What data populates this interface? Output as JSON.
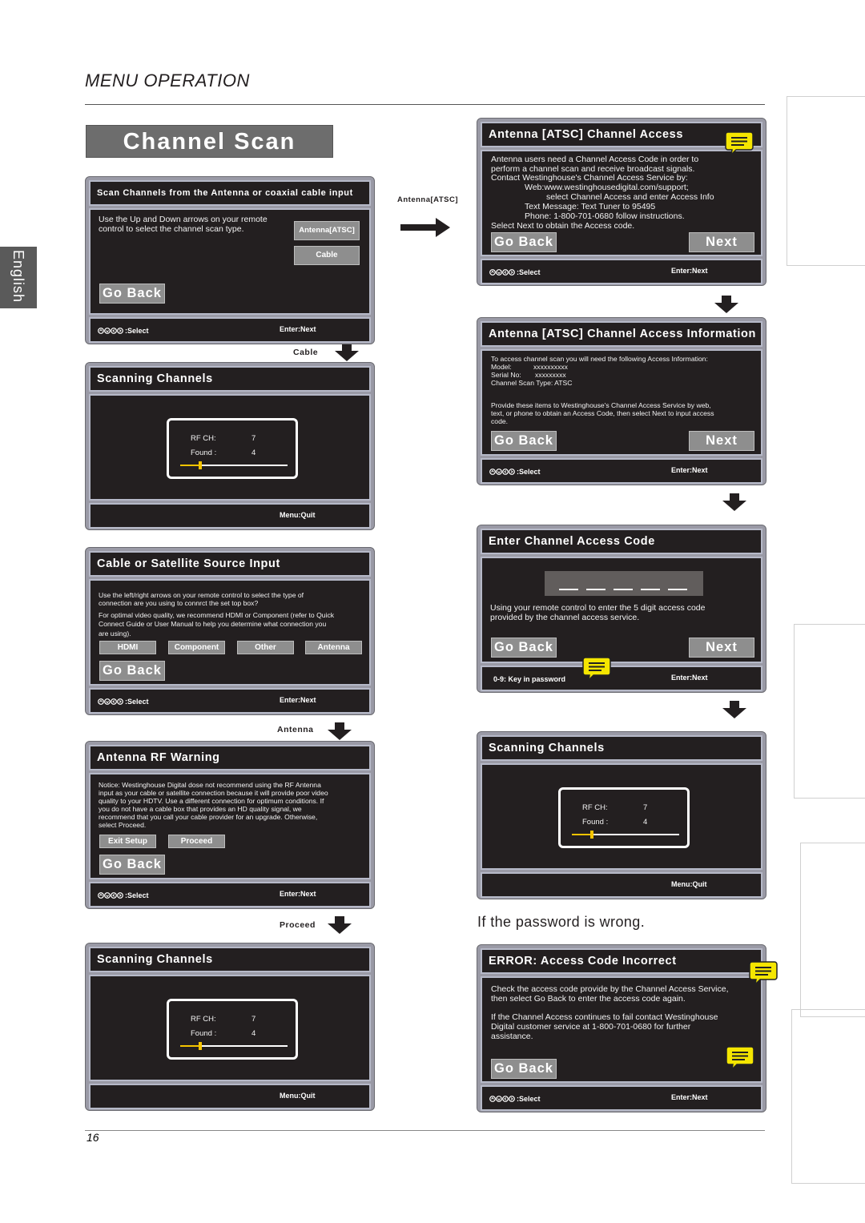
{
  "page": {
    "section_title": "MENU OPERATION",
    "banner": "Channel Scan",
    "language_tab": "English",
    "page_number": "16",
    "note_wrong_password": "If the password is wrong."
  },
  "colors": {
    "screen_bg": "#231f20",
    "button": "#8e8e8e",
    "note": "#f5e600",
    "progress": "#f5c400"
  },
  "icons": {
    "select": "four-direction-arrows-icon",
    "note": "speech-bubble-note-icon",
    "flow": "arrow-icon"
  },
  "flow": {
    "antenna_atsc": "Antenna[ATSC]",
    "cable": "Cable",
    "antenna": "Antenna",
    "proceed": "Proceed"
  },
  "common": {
    "go_back": "Go Back",
    "next": "Next",
    "select": ":Select",
    "enter_next": "Enter:Next",
    "menu_quit": "Menu:Quit",
    "rf_ch": "RF  CH:",
    "rf_ch_value": "7",
    "found": "Found :",
    "found_value": "4",
    "scan_progress_percent": 17
  },
  "l1": {
    "title": "Scan Channels from the Antenna or coaxial cable input",
    "text": [
      "Use the Up and Down arrows on your remote",
      "control to select the channel scan type."
    ],
    "options": [
      "Antenna[ATSC]",
      "Cable"
    ]
  },
  "l2": {
    "title": "Scanning Channels"
  },
  "l3": {
    "title": "Cable or Satellite Source Input",
    "text": [
      "Use the left/right arrows on your remote control to select the type of",
      "connection are you using to connrct the set top box?",
      "For optimal video quality, we recommend HDMI or Component (refer to Quick",
      "Connect Guide or User Manual to help you determine what connection you",
      "are using)."
    ],
    "options": [
      "HDMI",
      "Component",
      "Other",
      "Antenna"
    ]
  },
  "l4": {
    "title": "Antenna RF Warning",
    "text": [
      "Notice: Westinghouse Digital dose not recommend using the RF Antenna",
      "input as your cable or satellite connection because it will provide poor video",
      "quality to your HDTV. Use a different connection for optimum conditions. If",
      "you do not have a cable box that provides an HD quality signal, we",
      "recommend that you call your cable provider for an upgrade. Otherwise,",
      "select Proceed."
    ],
    "options": [
      "Exit Setup",
      "Proceed"
    ]
  },
  "l5": {
    "title": "Scanning Channels"
  },
  "r1": {
    "title": "Antenna [ATSC] Channel Access",
    "text": [
      "Antenna users need a Channel Access Code in order to",
      "perform a channel scan and receive broadcast signals.",
      "Contact Westinghouse's Channel Access Service by:",
      "Web:www.westinghousedigital.com/support;",
      "select Channel Access and enter Access Info",
      "Text Message: Text Tuner to 95495",
      "Phone: 1-800-701-0680 follow instructions.",
      "Select Next to obtain the Access code."
    ]
  },
  "r2": {
    "title": "Antenna [ATSC] Channel Access Information",
    "text": [
      "To access channel scan you will need the following Access Information:",
      "Model:",
      "xxxxxxxxxx",
      "Serial No:",
      "xxxxxxxxx",
      "Channel Scan Type: ATSC",
      "Provide these items to Westinghouse's Channel Access Service by web,",
      "text, or phone to obtain an Access Code, then select Next to input access",
      "code."
    ]
  },
  "r3": {
    "title": "Enter Channel Access Code",
    "text": [
      "Using your remote control to enter the 5 digit access code",
      "provided by the channel access service."
    ],
    "footer": "0-9: Key in password",
    "code_digits": 5
  },
  "r4": {
    "title": "Scanning Channels"
  },
  "r5": {
    "title": "ERROR: Access Code Incorrect",
    "text": [
      "Check the access code provide by the Channel Access Service,",
      "then select Go Back to enter the access code again.",
      "If the Channel Access continues to fail contact Westinghouse",
      "Digital customer service at 1-800-701-0680 for further",
      "assistance."
    ]
  }
}
